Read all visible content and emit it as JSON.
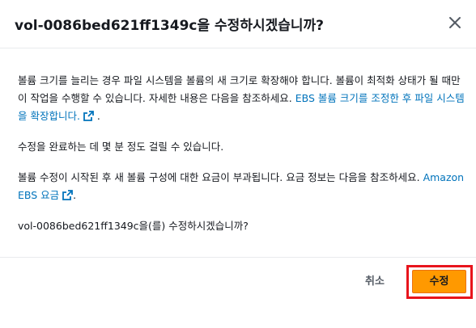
{
  "dialog": {
    "title": "vol-0086bed621ff1349c을 수정하시겠습니까?",
    "para1_text": "볼륨 크기를 늘리는 경우 파일 시스템을 볼륨의 새 크기로 확장해야 합니다. 볼륨이 최적화 상태가 될 때만 이 작업을 수행할 수 있습니다. 자세한 내용은 다음을 참조하세요. ",
    "para1_link": "EBS 볼륨 크기를 조정한 후 파일 시스템을 확장합니다.",
    "para1_end": " .",
    "para2_text": "수정을 완료하는 데 몇 분 정도 걸릴 수 있습니다.",
    "para3_text": "볼륨 수정이 시작된 후 새 볼륨 구성에 대한 요금이 부과됩니다. 요금 정보는 다음을 참조하세요. ",
    "para3_link": "Amazon EBS 요금",
    "para3_end": ".",
    "para4_text": "vol-0086bed621ff1349c을(를) 수정하시겠습니까?",
    "cancel_label": "취소",
    "confirm_label": "수정"
  },
  "icons": {
    "close": "close-icon",
    "external": "external-link-icon"
  },
  "colors": {
    "link": "#0073bb",
    "primary_button": "#ff9900",
    "highlight_frame": "#e8141c"
  }
}
